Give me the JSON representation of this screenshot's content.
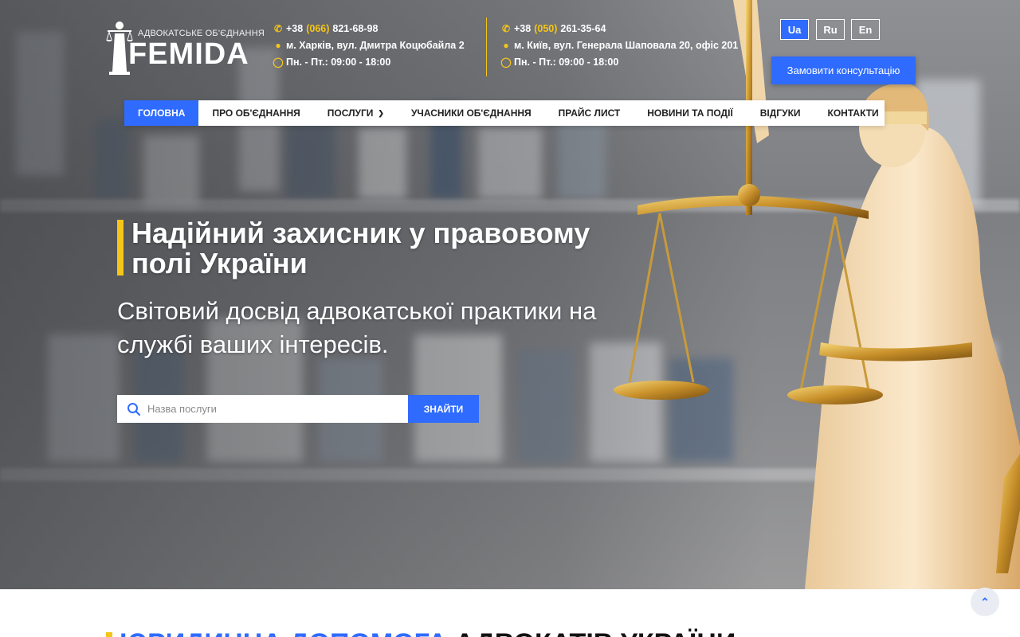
{
  "logo": {
    "subtitle": "АДВОКАТСЬКЕ ОБ'ЄДНАННЯ",
    "name": "FEMIDA"
  },
  "contacts": [
    {
      "phone_prefix": "+38",
      "phone_code": "(066)",
      "phone_number": "821-68-98",
      "address": "м. Харків, вул. Дмитра Коцюбайла 2",
      "hours": "Пн. - Пт.: 09:00 - 18:00"
    },
    {
      "phone_prefix": "+38",
      "phone_code": "(050)",
      "phone_number": "261-35-64",
      "address": "м. Київ, вул. Генерала Шаповала 20, офіс 201",
      "hours": "Пн. - Пт.: 09:00 - 18:00"
    }
  ],
  "languages": [
    "Ua",
    "Ru",
    "En"
  ],
  "consult_button": "Замовити консультацію",
  "nav": [
    {
      "label": "ГОЛОВНА"
    },
    {
      "label": "ПРО ОБ'ЄДНАННЯ"
    },
    {
      "label": "ПОСЛУГИ"
    },
    {
      "label": "УЧАСНИКИ ОБ'ЄДНАННЯ"
    },
    {
      "label": "ПРАЙС ЛИСТ"
    },
    {
      "label": "НОВИНИ ТА ПОДІЇ"
    },
    {
      "label": "ВІДГУКИ"
    },
    {
      "label": "КОНТАКТИ"
    }
  ],
  "hero": {
    "title": "Надійний захисник у правовому полі України",
    "subtitle": "Світовий досвід адвокатської практики на службі ваших інтересів."
  },
  "search": {
    "placeholder": "Назва послуги",
    "button": "ЗНАЙТИ"
  },
  "section": {
    "title_blue": "ЮРИДИЧНА ДОПОМОГА",
    "title_dark": "АДВОКАТІВ УКРАЇНИ"
  },
  "colors": {
    "accent": "#2f6bff",
    "highlight": "#f5c518"
  },
  "icons": {
    "phone": "phone-icon",
    "location": "map-marker-icon",
    "hours": "clock-icon",
    "search": "search-icon",
    "to_top": "chevron-up-icon"
  }
}
